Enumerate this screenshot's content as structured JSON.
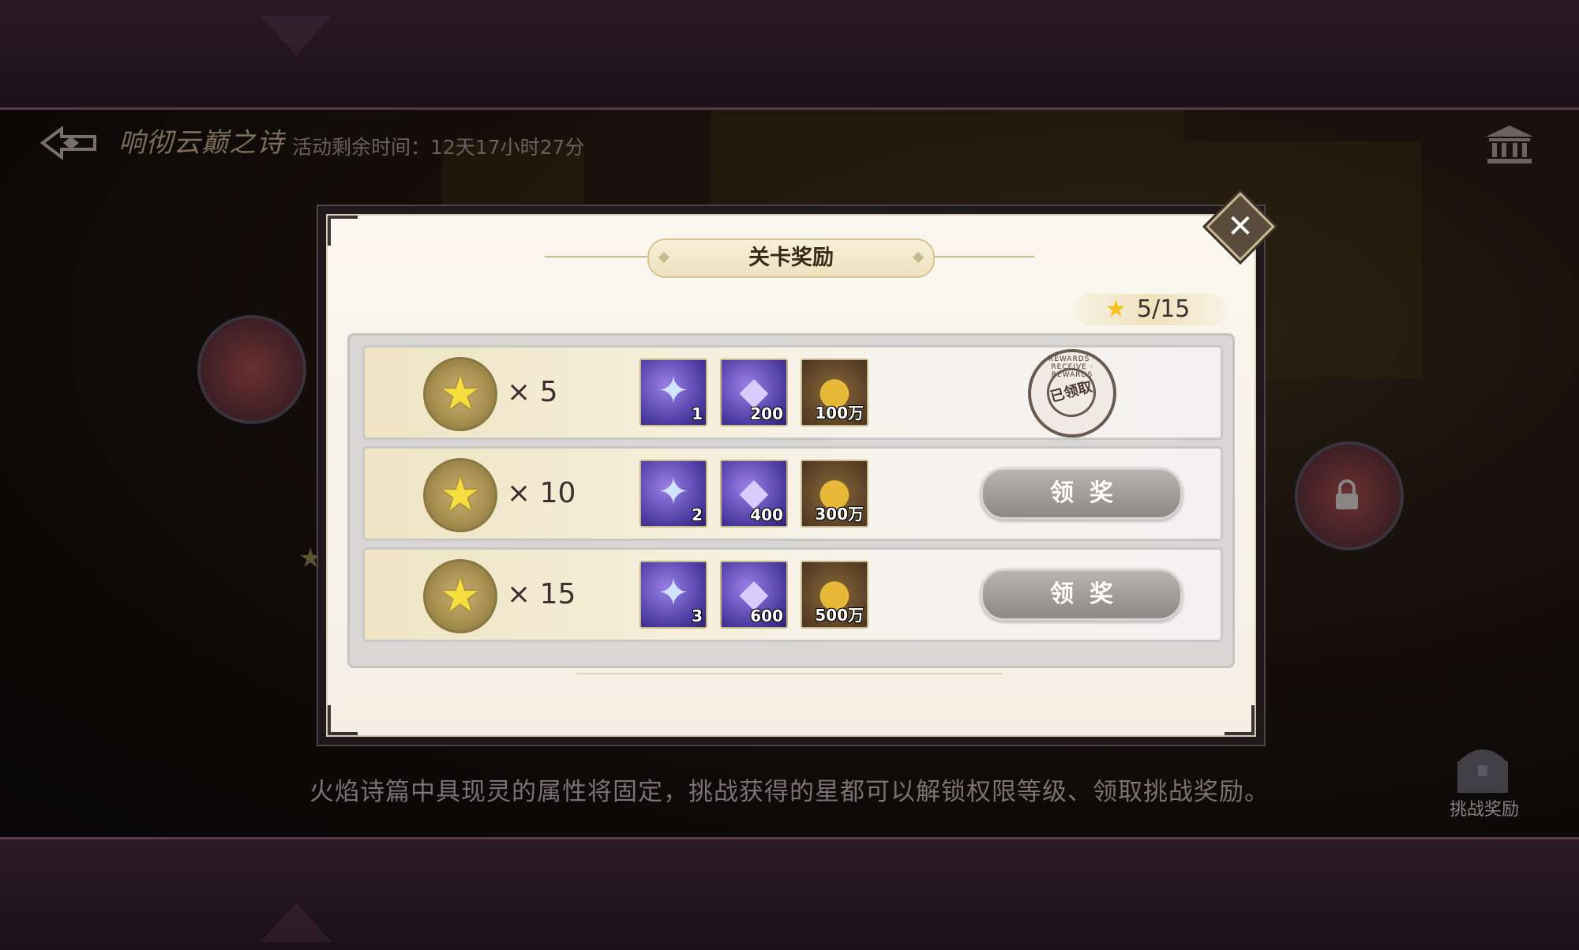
{
  "header": {
    "back_icon": "back-arrow-icon",
    "logo_text": "响彻云巅之诗",
    "timer": "活动剩余时间：12天17小时27分",
    "museum_icon": "museum-icon"
  },
  "scene": {
    "hint": "火焰诗篇中具现灵的属性将固定，挑战获得的星都可以解锁权限等级、领取挑战奖励。",
    "challenge_reward_label": "挑战奖励"
  },
  "modal": {
    "title": "关卡奖励",
    "star_progress": "5/15",
    "close_symbol": "✕",
    "rows": [
      {
        "requirement": "× 5",
        "items": [
          {
            "icon": "crystal-key-icon",
            "count": "1"
          },
          {
            "icon": "purple-shard-icon",
            "count": "200"
          },
          {
            "icon": "gold-coin-icon",
            "count": "100万"
          }
        ],
        "status": "claimed",
        "stamp_text": "已领取",
        "stamp_ring": "REWARDS · RECEIVE · REWARDS"
      },
      {
        "requirement": "× 10",
        "items": [
          {
            "icon": "crystal-key-icon",
            "count": "2"
          },
          {
            "icon": "purple-shard-icon",
            "count": "400"
          },
          {
            "icon": "gold-coin-icon",
            "count": "300万"
          }
        ],
        "status": "unclaimed",
        "button_label": "领奖"
      },
      {
        "requirement": "× 15",
        "items": [
          {
            "icon": "crystal-key-icon",
            "count": "3"
          },
          {
            "icon": "purple-shard-icon",
            "count": "600"
          },
          {
            "icon": "gold-coin-icon",
            "count": "500万"
          }
        ],
        "status": "unclaimed",
        "button_label": "领奖"
      }
    ]
  },
  "colors": {
    "star": "#f7de40",
    "button_gray": "#9a9694",
    "panel_cream": "#f6f2e8"
  }
}
